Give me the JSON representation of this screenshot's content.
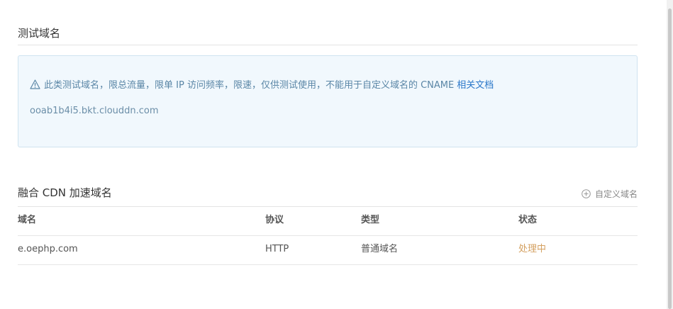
{
  "test_section": {
    "title": "测试域名",
    "notice_text": "此类测试域名，限总流量，限单 IP 访问频率，限速，仅供测试使用，不能用于自定义域名的 CNAME",
    "doc_link_label": "相关文档",
    "test_domain": "ooab1b4i5.bkt.clouddn.com"
  },
  "cdn_section": {
    "title": "融合 CDN 加速域名",
    "add_button_label": "自定义域名",
    "table": {
      "headers": [
        "域名",
        "协议",
        "类型",
        "状态"
      ],
      "rows": [
        {
          "domain": "e.oephp.com",
          "protocol": "HTTP",
          "type": "普通域名",
          "status": "处理中"
        }
      ]
    }
  },
  "colors": {
    "notice_bg": "#f1f8fd",
    "link": "#2a77c9",
    "status_processing": "#d4a060"
  }
}
